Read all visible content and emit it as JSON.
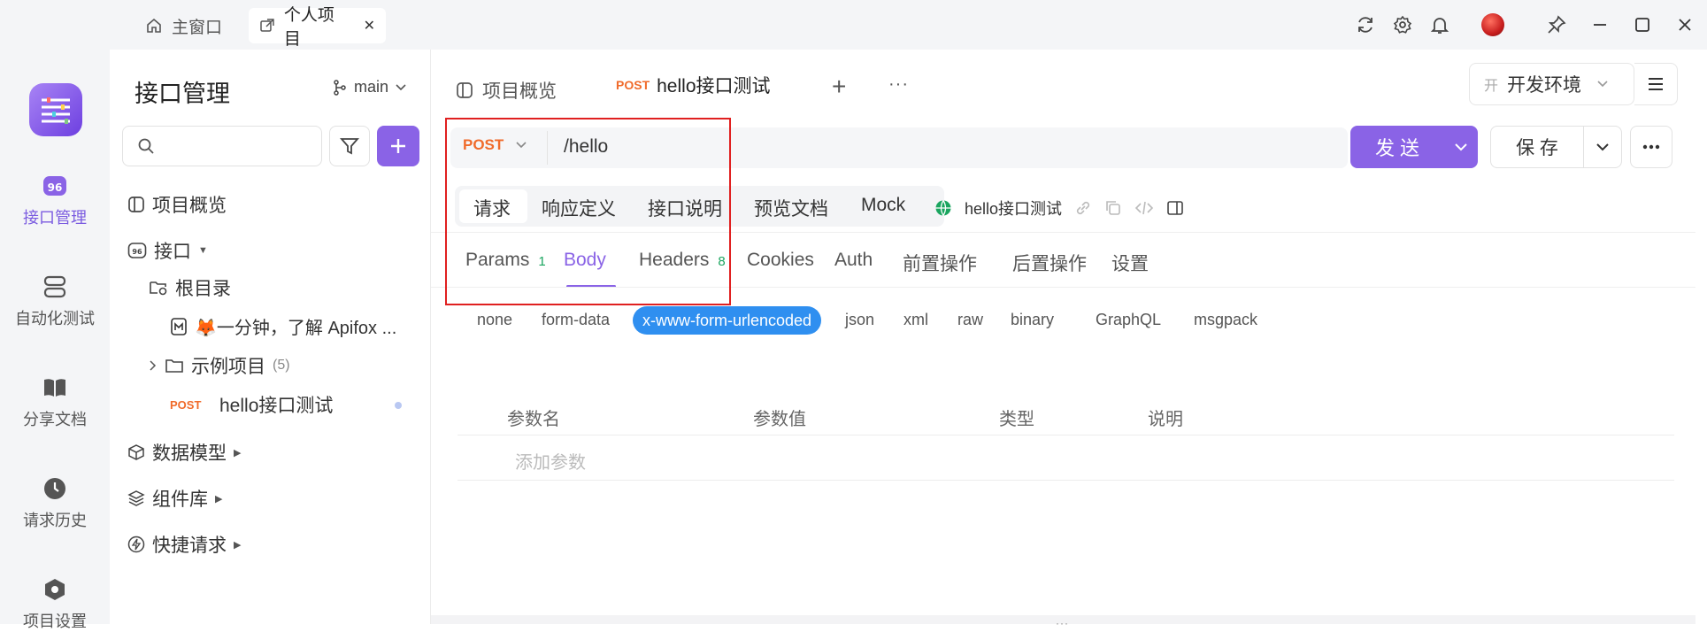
{
  "titlebar": {
    "tabs": [
      {
        "label": "主窗口",
        "icon": "home-icon"
      },
      {
        "label": "个人项目",
        "icon": "external-link-icon"
      }
    ],
    "close_glyph": "✕"
  },
  "rail": {
    "items": [
      {
        "label": "接口管理",
        "icon": "api-icon"
      },
      {
        "label": "自动化测试",
        "icon": "automation-icon"
      },
      {
        "label": "分享文档",
        "icon": "book-icon"
      },
      {
        "label": "请求历史",
        "icon": "clock-icon"
      },
      {
        "label": "项目设置",
        "icon": "hexagon-settings-icon"
      }
    ],
    "active_color": "#7b5ce0"
  },
  "sidebar": {
    "title": "接口管理",
    "branch": "main",
    "tree": {
      "overview": "项目概览",
      "interfaces": "接口",
      "root": "根目录",
      "doc_item": "🦊一分钟，了解 Apifox ...",
      "example_folder": "示例项目",
      "example_count": "(5)",
      "post_method": "POST",
      "post_item": "hello接口测试",
      "data_model": "数据模型",
      "components": "组件库",
      "quick_request": "快捷请求"
    }
  },
  "main": {
    "tabs": {
      "overview": "项目概览",
      "active_method": "POST",
      "active_name": "hello接口测试",
      "add": "+",
      "more": "···"
    },
    "env": {
      "badge": "开",
      "label": "开发环境"
    },
    "request": {
      "method": "POST",
      "url": "/hello",
      "send": "发 送",
      "save": "保 存"
    },
    "sections": [
      "请求",
      "响应定义",
      "接口说明",
      "预览文档",
      "Mock"
    ],
    "api_name": "hello接口测试",
    "subtabs": {
      "params": "Params",
      "params_count": "1",
      "body": "Body",
      "headers": "Headers",
      "headers_count": "8",
      "cookies": "Cookies",
      "auth": "Auth",
      "pre": "前置操作",
      "post": "后置操作",
      "settings": "设置"
    },
    "body_types": [
      "none",
      "form-data",
      "x-www-form-urlencoded",
      "json",
      "xml",
      "raw",
      "binary",
      "GraphQL",
      "msgpack"
    ],
    "table": {
      "headers": [
        "参数名",
        "参数值",
        "类型",
        "说明"
      ],
      "placeholder": "添加参数"
    }
  },
  "colors": {
    "accent": "#8a63e6",
    "post": "#f06b2b",
    "highlight_box": "#e02020",
    "selected_pill": "#2f8ff0",
    "count_green": "#1aa55f"
  }
}
